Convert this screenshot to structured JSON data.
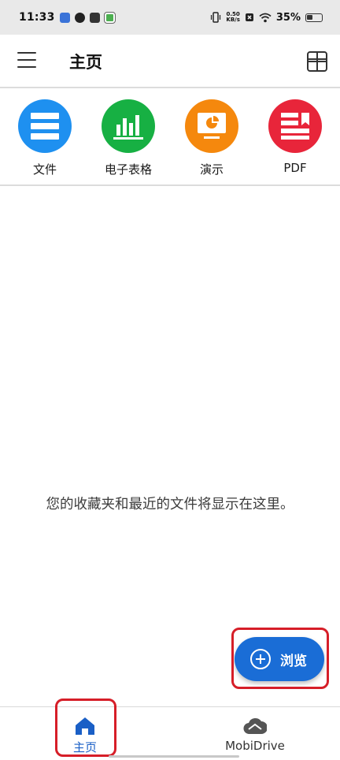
{
  "status_bar": {
    "time": "11:33",
    "net_speed_value": "0.50",
    "net_speed_unit": "KB/s",
    "battery": "35%"
  },
  "header": {
    "title": "主页"
  },
  "categories": [
    {
      "label": "文件",
      "color": "#1e90f0",
      "icon": "documents-icon"
    },
    {
      "label": "电子表格",
      "color": "#17b043",
      "icon": "spreadsheet-icon"
    },
    {
      "label": "演示",
      "color": "#f5880d",
      "icon": "presentation-icon"
    },
    {
      "label": "PDF",
      "color": "#e8253a",
      "icon": "pdf-icon"
    }
  ],
  "empty_message": "您的收藏夹和最近的文件将显示在这里。",
  "fab": {
    "label": "浏览",
    "color": "#1a6dd6"
  },
  "bottom_nav": [
    {
      "label": "主页",
      "active": true
    },
    {
      "label": "MobiDrive",
      "active": false
    }
  ],
  "colors": {
    "accent": "#1a5fc6",
    "highlight": "#d61e28"
  }
}
